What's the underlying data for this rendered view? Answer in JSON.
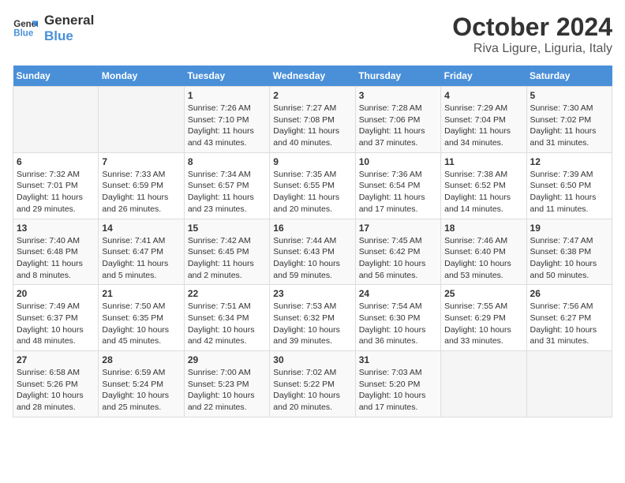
{
  "logo": {
    "line1": "General",
    "line2": "Blue"
  },
  "title": "October 2024",
  "subtitle": "Riva Ligure, Liguria, Italy",
  "days_of_week": [
    "Sunday",
    "Monday",
    "Tuesday",
    "Wednesday",
    "Thursday",
    "Friday",
    "Saturday"
  ],
  "weeks": [
    [
      {
        "day": "",
        "sunrise": "",
        "sunset": "",
        "daylight": ""
      },
      {
        "day": "",
        "sunrise": "",
        "sunset": "",
        "daylight": ""
      },
      {
        "day": "1",
        "sunrise": "Sunrise: 7:26 AM",
        "sunset": "Sunset: 7:10 PM",
        "daylight": "Daylight: 11 hours and 43 minutes."
      },
      {
        "day": "2",
        "sunrise": "Sunrise: 7:27 AM",
        "sunset": "Sunset: 7:08 PM",
        "daylight": "Daylight: 11 hours and 40 minutes."
      },
      {
        "day": "3",
        "sunrise": "Sunrise: 7:28 AM",
        "sunset": "Sunset: 7:06 PM",
        "daylight": "Daylight: 11 hours and 37 minutes."
      },
      {
        "day": "4",
        "sunrise": "Sunrise: 7:29 AM",
        "sunset": "Sunset: 7:04 PM",
        "daylight": "Daylight: 11 hours and 34 minutes."
      },
      {
        "day": "5",
        "sunrise": "Sunrise: 7:30 AM",
        "sunset": "Sunset: 7:02 PM",
        "daylight": "Daylight: 11 hours and 31 minutes."
      }
    ],
    [
      {
        "day": "6",
        "sunrise": "Sunrise: 7:32 AM",
        "sunset": "Sunset: 7:01 PM",
        "daylight": "Daylight: 11 hours and 29 minutes."
      },
      {
        "day": "7",
        "sunrise": "Sunrise: 7:33 AM",
        "sunset": "Sunset: 6:59 PM",
        "daylight": "Daylight: 11 hours and 26 minutes."
      },
      {
        "day": "8",
        "sunrise": "Sunrise: 7:34 AM",
        "sunset": "Sunset: 6:57 PM",
        "daylight": "Daylight: 11 hours and 23 minutes."
      },
      {
        "day": "9",
        "sunrise": "Sunrise: 7:35 AM",
        "sunset": "Sunset: 6:55 PM",
        "daylight": "Daylight: 11 hours and 20 minutes."
      },
      {
        "day": "10",
        "sunrise": "Sunrise: 7:36 AM",
        "sunset": "Sunset: 6:54 PM",
        "daylight": "Daylight: 11 hours and 17 minutes."
      },
      {
        "day": "11",
        "sunrise": "Sunrise: 7:38 AM",
        "sunset": "Sunset: 6:52 PM",
        "daylight": "Daylight: 11 hours and 14 minutes."
      },
      {
        "day": "12",
        "sunrise": "Sunrise: 7:39 AM",
        "sunset": "Sunset: 6:50 PM",
        "daylight": "Daylight: 11 hours and 11 minutes."
      }
    ],
    [
      {
        "day": "13",
        "sunrise": "Sunrise: 7:40 AM",
        "sunset": "Sunset: 6:48 PM",
        "daylight": "Daylight: 11 hours and 8 minutes."
      },
      {
        "day": "14",
        "sunrise": "Sunrise: 7:41 AM",
        "sunset": "Sunset: 6:47 PM",
        "daylight": "Daylight: 11 hours and 5 minutes."
      },
      {
        "day": "15",
        "sunrise": "Sunrise: 7:42 AM",
        "sunset": "Sunset: 6:45 PM",
        "daylight": "Daylight: 11 hours and 2 minutes."
      },
      {
        "day": "16",
        "sunrise": "Sunrise: 7:44 AM",
        "sunset": "Sunset: 6:43 PM",
        "daylight": "Daylight: 10 hours and 59 minutes."
      },
      {
        "day": "17",
        "sunrise": "Sunrise: 7:45 AM",
        "sunset": "Sunset: 6:42 PM",
        "daylight": "Daylight: 10 hours and 56 minutes."
      },
      {
        "day": "18",
        "sunrise": "Sunrise: 7:46 AM",
        "sunset": "Sunset: 6:40 PM",
        "daylight": "Daylight: 10 hours and 53 minutes."
      },
      {
        "day": "19",
        "sunrise": "Sunrise: 7:47 AM",
        "sunset": "Sunset: 6:38 PM",
        "daylight": "Daylight: 10 hours and 50 minutes."
      }
    ],
    [
      {
        "day": "20",
        "sunrise": "Sunrise: 7:49 AM",
        "sunset": "Sunset: 6:37 PM",
        "daylight": "Daylight: 10 hours and 48 minutes."
      },
      {
        "day": "21",
        "sunrise": "Sunrise: 7:50 AM",
        "sunset": "Sunset: 6:35 PM",
        "daylight": "Daylight: 10 hours and 45 minutes."
      },
      {
        "day": "22",
        "sunrise": "Sunrise: 7:51 AM",
        "sunset": "Sunset: 6:34 PM",
        "daylight": "Daylight: 10 hours and 42 minutes."
      },
      {
        "day": "23",
        "sunrise": "Sunrise: 7:53 AM",
        "sunset": "Sunset: 6:32 PM",
        "daylight": "Daylight: 10 hours and 39 minutes."
      },
      {
        "day": "24",
        "sunrise": "Sunrise: 7:54 AM",
        "sunset": "Sunset: 6:30 PM",
        "daylight": "Daylight: 10 hours and 36 minutes."
      },
      {
        "day": "25",
        "sunrise": "Sunrise: 7:55 AM",
        "sunset": "Sunset: 6:29 PM",
        "daylight": "Daylight: 10 hours and 33 minutes."
      },
      {
        "day": "26",
        "sunrise": "Sunrise: 7:56 AM",
        "sunset": "Sunset: 6:27 PM",
        "daylight": "Daylight: 10 hours and 31 minutes."
      }
    ],
    [
      {
        "day": "27",
        "sunrise": "Sunrise: 6:58 AM",
        "sunset": "Sunset: 5:26 PM",
        "daylight": "Daylight: 10 hours and 28 minutes."
      },
      {
        "day": "28",
        "sunrise": "Sunrise: 6:59 AM",
        "sunset": "Sunset: 5:24 PM",
        "daylight": "Daylight: 10 hours and 25 minutes."
      },
      {
        "day": "29",
        "sunrise": "Sunrise: 7:00 AM",
        "sunset": "Sunset: 5:23 PM",
        "daylight": "Daylight: 10 hours and 22 minutes."
      },
      {
        "day": "30",
        "sunrise": "Sunrise: 7:02 AM",
        "sunset": "Sunset: 5:22 PM",
        "daylight": "Daylight: 10 hours and 20 minutes."
      },
      {
        "day": "31",
        "sunrise": "Sunrise: 7:03 AM",
        "sunset": "Sunset: 5:20 PM",
        "daylight": "Daylight: 10 hours and 17 minutes."
      },
      {
        "day": "",
        "sunrise": "",
        "sunset": "",
        "daylight": ""
      },
      {
        "day": "",
        "sunrise": "",
        "sunset": "",
        "daylight": ""
      }
    ]
  ]
}
